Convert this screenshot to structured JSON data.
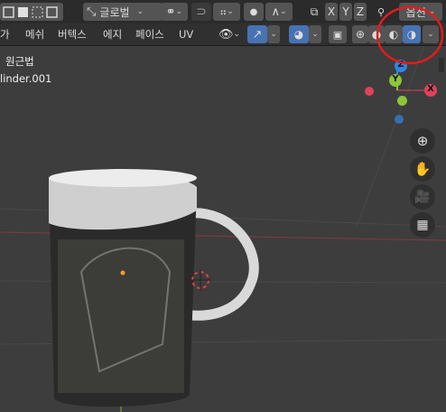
{
  "header": {
    "transform_orientation": "글로벌",
    "axis_x": "X",
    "axis_y": "Y",
    "axis_z": "Z",
    "options_label": "옵션"
  },
  "menu": {
    "items": [
      "가",
      "메쉬",
      "버텍스",
      "에지",
      "페이스",
      "UV"
    ]
  },
  "viewport": {
    "view_label": "원근법",
    "object_name": "linder.001"
  },
  "gizmo": {
    "x_label": "X",
    "y_label": "Y",
    "z_label": "Z"
  },
  "colors": {
    "accent": "#4772b3",
    "x_axis": "#e0425b",
    "y_axis": "#8cc43b",
    "z_axis": "#2f86e0",
    "annotation": "#e31b1b"
  }
}
